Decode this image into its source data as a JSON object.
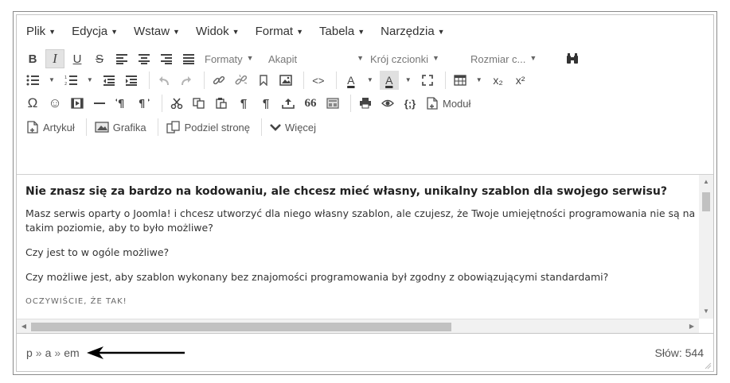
{
  "menubar": {
    "items": [
      {
        "label": "Plik"
      },
      {
        "label": "Edycja"
      },
      {
        "label": "Wstaw"
      },
      {
        "label": "Widok"
      },
      {
        "label": "Format"
      },
      {
        "label": "Tabela"
      },
      {
        "label": "Narzędzia"
      }
    ]
  },
  "toolbar": {
    "formats_label": "Formaty",
    "block_label": "Akapit",
    "font_label": "Krój czcionki",
    "size_label": "Rozmiar c...",
    "module_label": "Moduł",
    "article_label": "Artykuł",
    "image_label": "Grafika",
    "pagebreak_label": "Podziel stronę",
    "readmore_label": "Więcej",
    "bold_glyph": "B",
    "italic_glyph": "I",
    "underline_glyph": "U",
    "strike_glyph": "S",
    "omega_glyph": "Ω",
    "smiley_glyph": "☺",
    "pilcrow_glyph": "¶",
    "quote_glyph": "66",
    "curly_glyph": "{;}",
    "code_glyph": "<>",
    "textcolor_glyph": "A",
    "bgcolor_glyph": "A",
    "subscript_glyph": "x₂",
    "superscript_glyph": "x²"
  },
  "content": {
    "heading": "Nie znasz się za bardzo na kodowaniu, ale chcesz mieć własny, unikalny szablon dla swojego serwisu?",
    "p1": "Masz serwis oparty o Joomla! i chcesz utworzyć dla niego własny szablon, ale czujesz, że Twoje umiejętności programowania nie są na takim poziomie, aby to było możliwe?",
    "p2": "Czy jest to w ogóle możliwe?",
    "p3": "Czy możliwe jest, aby szablon wykonany bez znajomości programowania był zgodny z obowiązującymi standardami?",
    "p4": "OCZYWIŚCIE, ŻE TAK!"
  },
  "statusbar": {
    "path": [
      "p",
      "a",
      "em"
    ],
    "path_separator": "»",
    "wordcount": "Słów: 544"
  },
  "colors": {
    "text": "#333333",
    "border": "#c5c5c5",
    "scroll_thumb": "#c1c1c1"
  }
}
